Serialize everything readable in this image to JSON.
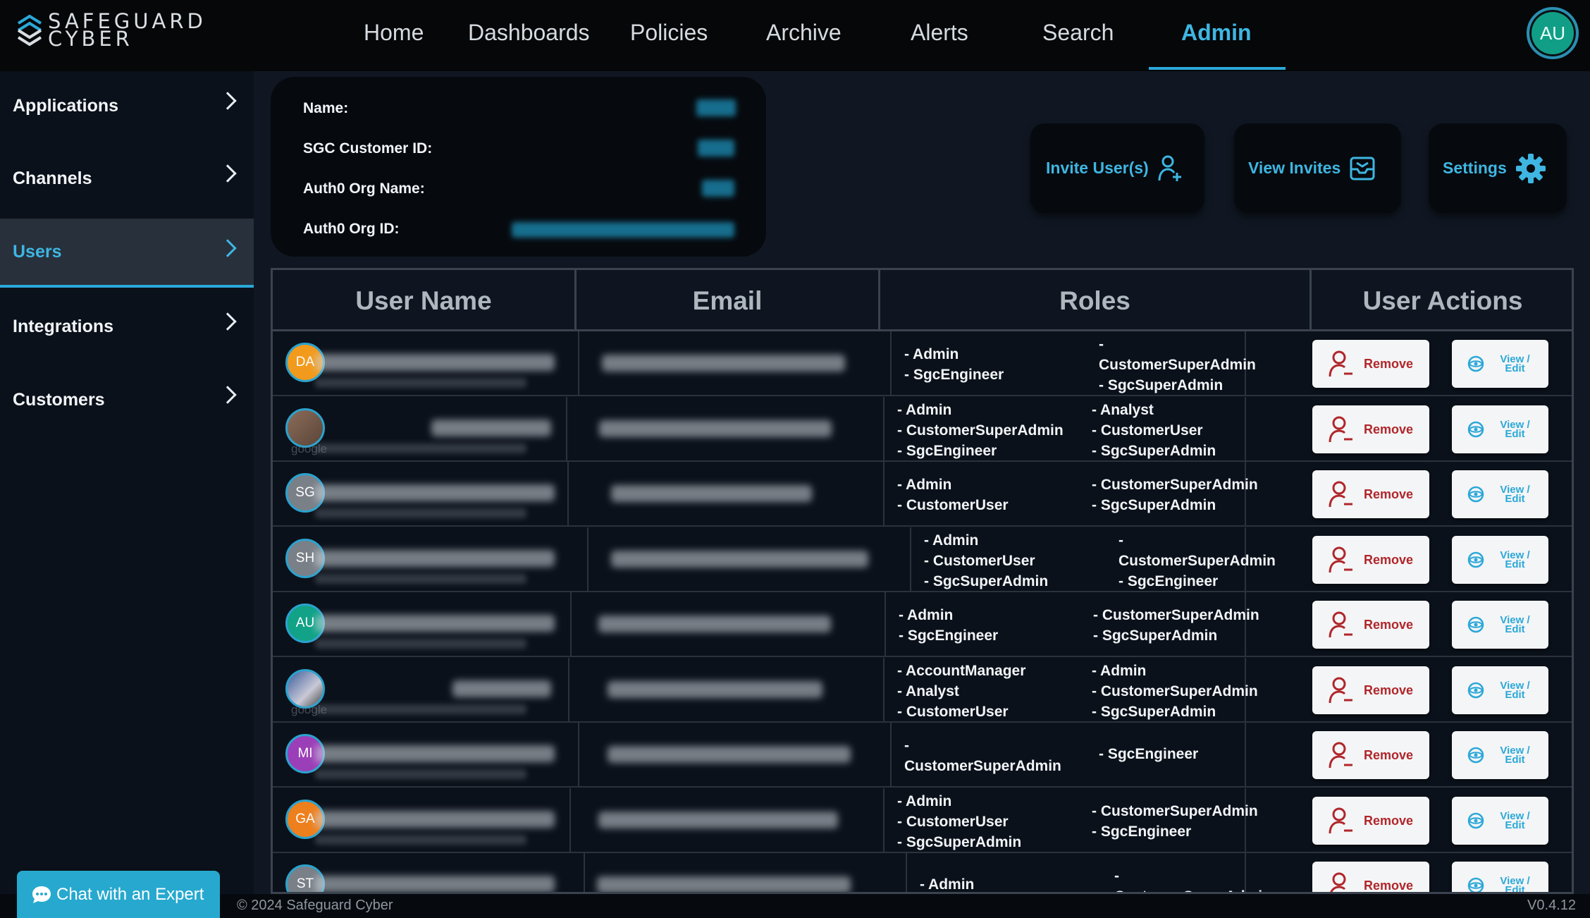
{
  "brand": {
    "line1": "SAFEGUARD",
    "line2": "CYBER"
  },
  "nav": {
    "items": [
      "Home",
      "Dashboards",
      "Policies",
      "Archive",
      "Alerts",
      "Search",
      "Admin"
    ],
    "active": "Admin"
  },
  "user_avatar": "AU",
  "sidebar": {
    "items": [
      {
        "label": "Applications"
      },
      {
        "label": "Channels"
      },
      {
        "label": "Users"
      },
      {
        "label": "Integrations"
      },
      {
        "label": "Customers"
      }
    ],
    "active": "Users"
  },
  "org_info": {
    "name_label": "Name:",
    "customer_id_label": "SGC Customer ID:",
    "auth0_org_name_label": "Auth0 Org Name:",
    "auth0_org_id_label": "Auth0 Org ID:"
  },
  "actions": {
    "invite": "Invite User(s)",
    "view_invites": "View Invites",
    "settings": "Settings"
  },
  "table": {
    "headers": [
      "User Name",
      "Email",
      "Roles",
      "User Actions"
    ],
    "remove_label": "Remove",
    "view_label_1": "View /",
    "view_label_2": "Edit",
    "rows": [
      {
        "initials": "DA",
        "color": "#f29a1c",
        "roles_left": [
          "- Admin",
          "- SgcEngineer"
        ],
        "roles_right": [
          "-",
          "CustomerSuperAdmin",
          "- SgcSuperAdmin"
        ]
      },
      {
        "initials": "",
        "color": "photo",
        "roles_left": [
          "- Admin",
          "- CustomerSuperAdmin",
          "- SgcEngineer"
        ],
        "roles_right": [
          "- Analyst",
          "- CustomerUser",
          "- SgcSuperAdmin"
        ],
        "sub": "google"
      },
      {
        "initials": "SG",
        "color": "#7a8088",
        "roles_left": [
          "- Admin",
          "- CustomerUser"
        ],
        "roles_right": [
          "- CustomerSuperAdmin",
          "- SgcSuperAdmin"
        ]
      },
      {
        "initials": "SH",
        "color": "#7a8088",
        "roles_left": [
          "- Admin",
          "- CustomerUser",
          "- SgcSuperAdmin"
        ],
        "roles_right": [
          "-",
          "CustomerSuperAdmin",
          "- SgcEngineer"
        ]
      },
      {
        "initials": "AU",
        "color": "#11a287",
        "roles_left": [
          "- Admin",
          "- SgcEngineer"
        ],
        "roles_right": [
          "- CustomerSuperAdmin",
          "- SgcSuperAdmin"
        ]
      },
      {
        "initials": "",
        "color": "photo2",
        "roles_left": [
          "- AccountManager",
          "- Analyst",
          "- CustomerUser"
        ],
        "roles_right": [
          "- Admin",
          "- CustomerSuperAdmin",
          "- SgcSuperAdmin"
        ],
        "sub": "google"
      },
      {
        "initials": "MI",
        "color": "#9b3fb8",
        "roles_left": [
          "-",
          "CustomerSuperAdmin"
        ],
        "roles_right": [
          "- SgcEngineer"
        ]
      },
      {
        "initials": "GA",
        "color": "#ee7f1d",
        "roles_left": [
          "- Admin",
          "- CustomerUser",
          "- SgcSuperAdmin"
        ],
        "roles_right": [
          "- CustomerSuperAdmin",
          "- SgcEngineer"
        ]
      },
      {
        "initials": "ST",
        "color": "#7a8088",
        "roles_left": [
          "- Admin"
        ],
        "roles_right": [
          "-",
          "CustomerSuperAdmin"
        ]
      }
    ]
  },
  "chat": {
    "label": "Chat with an Expert"
  },
  "footer": {
    "copyright": "© 2024 Safeguard Cyber",
    "version": "V0.4.12"
  }
}
